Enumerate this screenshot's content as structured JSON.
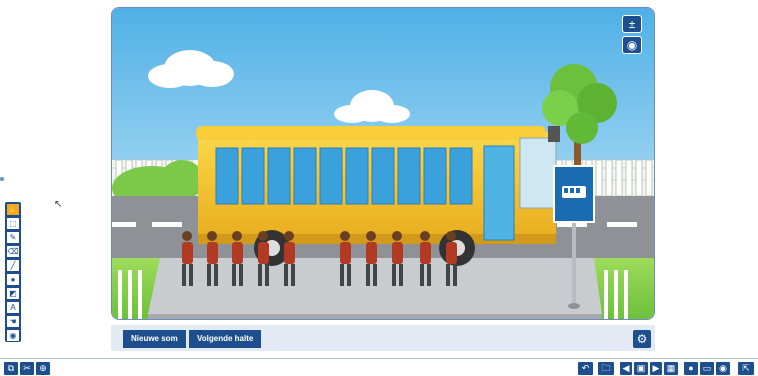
{
  "stage": {
    "new_sum_label": "Nieuwe som",
    "next_stop_label": "Volgende halte"
  },
  "scene_controls": {
    "zoom_icon": "plus-minus-icon",
    "view_icon": "eye-icon"
  },
  "tools": [
    {
      "icon": "pointer-icon",
      "glyph": "✋",
      "active": true
    },
    {
      "icon": "select-icon",
      "glyph": "⬚"
    },
    {
      "icon": "pen-icon",
      "glyph": "✎"
    },
    {
      "icon": "eraser-icon",
      "glyph": "⌫"
    },
    {
      "icon": "line-icon",
      "glyph": "╱"
    },
    {
      "icon": "circle-icon",
      "glyph": "●"
    },
    {
      "icon": "shape-icon",
      "glyph": "◩"
    },
    {
      "icon": "text-icon",
      "glyph": "A"
    },
    {
      "icon": "hand-icon",
      "glyph": "☚"
    },
    {
      "icon": "target-icon",
      "glyph": "◉"
    }
  ],
  "bottom_toolbar": {
    "left_icons": [
      "screenshot-icon",
      "tools-icon",
      "zoom-icon"
    ],
    "right_icons": [
      "undo-icon",
      "open-icon",
      "prev-icon",
      "page-icon",
      "next-icon",
      "grid-icon",
      "user-icon",
      "presenter-icon",
      "view-icon",
      "exit-icon"
    ]
  },
  "colors": {
    "accent": "#1d4f8f",
    "bus": "#f3c22b",
    "sky": "#7ec3ea",
    "grass": "#8fd14f"
  }
}
